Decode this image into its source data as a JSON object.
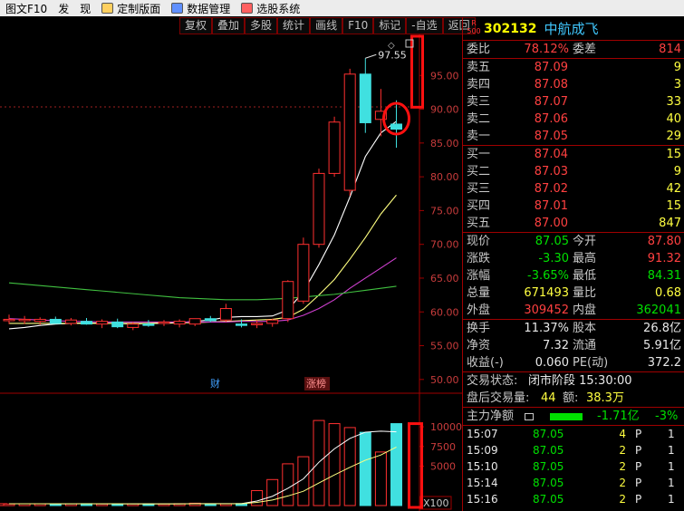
{
  "menu": [
    {
      "label": "图文F10",
      "icon": ""
    },
    {
      "label": "发",
      "icon": ""
    },
    {
      "label": "现",
      "icon": ""
    },
    {
      "label": "定制版面",
      "icon": "layout-icon"
    },
    {
      "label": "数据管理",
      "icon": "database-icon"
    },
    {
      "label": "选股系统",
      "icon": "stock-picker-icon"
    }
  ],
  "toolbar": [
    "复权",
    "叠加",
    "多股",
    "统计",
    "画线",
    "F10",
    "标记",
    "-自选",
    "返回"
  ],
  "stock": {
    "badge_top": "R",
    "badge_bottom": "500",
    "code": "302132",
    "name": "中航成飞"
  },
  "order_ratio": {
    "label1": "委比",
    "value1": "78.12%",
    "label2": "委差",
    "value2": "814"
  },
  "asks": [
    {
      "label": "卖五",
      "price": "87.09",
      "volume": "9"
    },
    {
      "label": "卖四",
      "price": "87.08",
      "volume": "3"
    },
    {
      "label": "卖三",
      "price": "87.07",
      "volume": "33"
    },
    {
      "label": "卖二",
      "price": "87.06",
      "volume": "40"
    },
    {
      "label": "卖一",
      "price": "87.05",
      "volume": "29"
    }
  ],
  "bids": [
    {
      "label": "买一",
      "price": "87.04",
      "volume": "15"
    },
    {
      "label": "买二",
      "price": "87.03",
      "volume": "9"
    },
    {
      "label": "买三",
      "price": "87.02",
      "volume": "42"
    },
    {
      "label": "买四",
      "price": "87.01",
      "volume": "15"
    },
    {
      "label": "买五",
      "price": "87.00",
      "volume": "847"
    }
  ],
  "quote": [
    {
      "l1": "现价",
      "v1": "87.05",
      "c1": "g",
      "l2": "今开",
      "v2": "87.80",
      "c2": "r"
    },
    {
      "l1": "涨跌",
      "v1": "-3.30",
      "c1": "g",
      "l2": "最高",
      "v2": "91.32",
      "c2": "r"
    },
    {
      "l1": "涨幅",
      "v1": "-3.65%",
      "c1": "g",
      "l2": "最低",
      "v2": "84.31",
      "c2": "g"
    },
    {
      "l1": "总量",
      "v1": "671493",
      "c1": "y",
      "l2": "量比",
      "v2": "0.68",
      "c2": "y"
    },
    {
      "l1": "外盘",
      "v1": "309452",
      "c1": "r",
      "l2": "内盘",
      "v2": "362041",
      "c2": "g"
    }
  ],
  "fundamentals": [
    {
      "l1": "换手",
      "v1": "11.37%",
      "l2": "股本",
      "v2": "26.8亿"
    },
    {
      "l1": "净资",
      "v1": "7.32",
      "l2": "流通",
      "v2": "5.91亿"
    },
    {
      "l1": "收益(-)",
      "v1": "0.060",
      "l2": "PE(动)",
      "v2": "372.2"
    }
  ],
  "trade_status": {
    "label": "交易状态:",
    "value": "闭市阶段 15:30:00"
  },
  "after_hours": {
    "label": "盘后交易量:",
    "vol": "44",
    "amount_label": "额:",
    "amount": "38.3万"
  },
  "main_flow": {
    "label": "主力净额",
    "value": "-1.71亿",
    "pct": "-3%"
  },
  "ticks": [
    {
      "time": "15:07",
      "price": "87.05",
      "vol": "4",
      "dir": "P",
      "num": "1"
    },
    {
      "time": "15:09",
      "price": "87.05",
      "vol": "2",
      "dir": "P",
      "num": "1"
    },
    {
      "time": "15:10",
      "price": "87.05",
      "vol": "2",
      "dir": "P",
      "num": "1"
    },
    {
      "time": "15:14",
      "price": "87.05",
      "vol": "2",
      "dir": "P",
      "num": "1"
    },
    {
      "time": "15:16",
      "price": "87.05",
      "vol": "2",
      "dir": "P",
      "num": "1"
    }
  ],
  "chart_data": {
    "type": "candlestick",
    "price_axis": {
      "ticks": [
        "95.00",
        "90.00",
        "85.00",
        "80.00",
        "75.00",
        "70.00",
        "65.00",
        "60.00",
        "55.00",
        "50.00"
      ],
      "range": [
        48.5,
        100
      ]
    },
    "high_annotation": "97.55",
    "reference_price": 90.35,
    "candles": [
      {
        "o": 58.8,
        "h": 59.6,
        "l": 58.2,
        "c": 58.9
      },
      {
        "o": 58.8,
        "h": 59.4,
        "l": 58.2,
        "c": 58.9
      },
      {
        "o": 58.6,
        "h": 59.2,
        "l": 58.1,
        "c": 58.9
      },
      {
        "o": 58.9,
        "h": 59.3,
        "l": 58.3,
        "c": 58.3
      },
      {
        "o": 58.3,
        "h": 59.1,
        "l": 58.0,
        "c": 58.8
      },
      {
        "o": 58.6,
        "h": 59.1,
        "l": 58.1,
        "c": 58.2
      },
      {
        "o": 58.2,
        "h": 58.9,
        "l": 57.6,
        "c": 58.6
      },
      {
        "o": 58.5,
        "h": 59.0,
        "l": 57.6,
        "c": 57.8
      },
      {
        "o": 57.7,
        "h": 58.5,
        "l": 57.3,
        "c": 58.2
      },
      {
        "o": 58.2,
        "h": 58.8,
        "l": 57.8,
        "c": 58.1
      },
      {
        "o": 58.3,
        "h": 58.8,
        "l": 57.9,
        "c": 58.5
      },
      {
        "o": 58.2,
        "h": 58.9,
        "l": 57.7,
        "c": 58.6
      },
      {
        "o": 58.2,
        "h": 59.0,
        "l": 57.9,
        "c": 59.0
      },
      {
        "o": 59.0,
        "h": 59.4,
        "l": 58.5,
        "c": 58.7
      },
      {
        "o": 58.8,
        "h": 61.2,
        "l": 58.5,
        "c": 60.5
      },
      {
        "o": 58.2,
        "h": 58.9,
        "l": 57.7,
        "c": 58.0
      },
      {
        "o": 58.2,
        "h": 58.8,
        "l": 57.6,
        "c": 58.3
      },
      {
        "o": 58.3,
        "h": 59.0,
        "l": 57.8,
        "c": 58.8
      },
      {
        "o": 59.0,
        "h": 64.7,
        "l": 58.5,
        "c": 64.5
      },
      {
        "o": 61.6,
        "h": 71.0,
        "l": 61.2,
        "c": 70.0
      },
      {
        "o": 70.0,
        "h": 81.2,
        "l": 69.5,
        "c": 80.5
      },
      {
        "o": 80.5,
        "h": 88.9,
        "l": 80.0,
        "c": 88.1
      },
      {
        "o": 78.0,
        "h": 96.0,
        "l": 77.2,
        "c": 95.2
      },
      {
        "o": 95.2,
        "h": 97.55,
        "l": 86.5,
        "c": 88.0
      },
      {
        "o": 88.5,
        "h": 93.0,
        "l": 86.0,
        "c": 89.7
      },
      {
        "o": 87.8,
        "h": 91.32,
        "l": 84.31,
        "c": 87.05
      }
    ],
    "ma": [
      {
        "name": "MA5",
        "color": "#ffffff",
        "values": [
          57.5,
          57.7,
          58.0,
          58.2,
          58.3,
          58.4,
          58.3,
          58.3,
          58.2,
          58.3,
          58.3,
          58.4,
          58.6,
          58.8,
          59.2,
          59.3,
          59.3,
          59.4,
          60.3,
          63.0,
          67.0,
          71.4,
          77.0,
          83.0,
          86.5,
          88.2
        ]
      },
      {
        "name": "MA10",
        "color": "#ffff80",
        "values": [
          58.3,
          58.3,
          58.3,
          58.3,
          58.3,
          58.3,
          58.3,
          58.3,
          58.3,
          58.3,
          58.4,
          58.4,
          58.4,
          58.5,
          58.6,
          58.7,
          58.8,
          58.9,
          59.2,
          60.4,
          62.5,
          64.8,
          67.8,
          71.0,
          74.5,
          77.3
        ]
      },
      {
        "name": "MA20",
        "color": "#d040d0",
        "values": [
          59.0,
          58.9,
          58.8,
          58.7,
          58.6,
          58.6,
          58.5,
          58.5,
          58.5,
          58.5,
          58.5,
          58.5,
          58.5,
          58.5,
          58.5,
          58.6,
          58.6,
          58.6,
          58.8,
          59.5,
          60.5,
          61.8,
          63.5,
          65.0,
          66.5,
          68.0
        ]
      },
      {
        "name": "MA60",
        "color": "#40c040",
        "values": [
          64.3,
          64.1,
          63.9,
          63.7,
          63.5,
          63.3,
          63.1,
          62.9,
          62.7,
          62.5,
          62.3,
          62.1,
          62.0,
          61.9,
          61.8,
          61.8,
          61.8,
          61.9,
          62.0,
          62.2,
          62.4,
          62.6,
          62.9,
          63.2,
          63.5,
          63.8
        ]
      }
    ],
    "markers": [
      "财",
      "涨榜"
    ],
    "volume_axis": {
      "ticks": [
        "10000",
        "7500",
        "5000"
      ],
      "unit": "X100",
      "max": 11500
    },
    "volumes": [
      260,
      240,
      200,
      230,
      220,
      200,
      230,
      240,
      210,
      200,
      230,
      220,
      210,
      240,
      300,
      230,
      220,
      250,
      1900,
      3300,
      5300,
      6200,
      10800,
      10400,
      9900,
      9300,
      6800,
      10400
    ]
  }
}
